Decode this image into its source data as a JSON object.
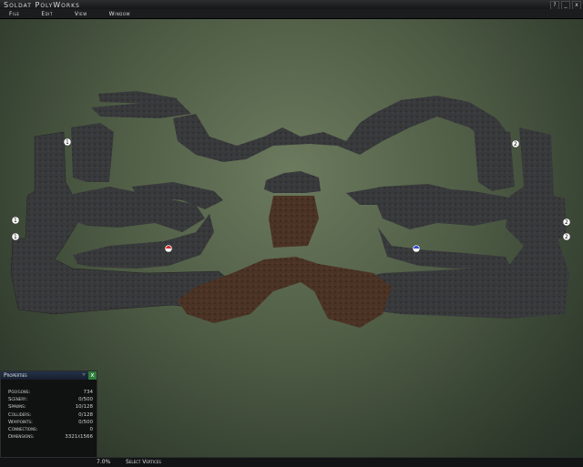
{
  "app": {
    "title": "Soldat PolyWorks"
  },
  "window_buttons": {
    "help": "?",
    "minimize": "_",
    "close": "x"
  },
  "menu": [
    "File",
    "Edit",
    "View",
    "Window"
  ],
  "properties": {
    "title": "Properties",
    "pin": "▿",
    "close": "x",
    "rows": [
      {
        "label": "Polygons:",
        "value": "734"
      },
      {
        "label": "Scenery:",
        "value": "0/500"
      },
      {
        "label": "Spawns:",
        "value": "10/128"
      },
      {
        "label": "Colliders:",
        "value": "0/128"
      },
      {
        "label": "Waypoints:",
        "value": "0/500"
      },
      {
        "label": "Connections:",
        "value": "0"
      },
      {
        "label": "Dimensions:",
        "value": "3321x1566"
      }
    ]
  },
  "status": {
    "zoom": "7.0%",
    "tool": "Select Vertices"
  },
  "spawn_labels": {
    "team1": "1",
    "team2": "2"
  },
  "colors": {
    "rock": "#3a3b3d",
    "dirt": "#4a3324",
    "team1": "#d22a2a",
    "team2": "#2a4ad2"
  }
}
